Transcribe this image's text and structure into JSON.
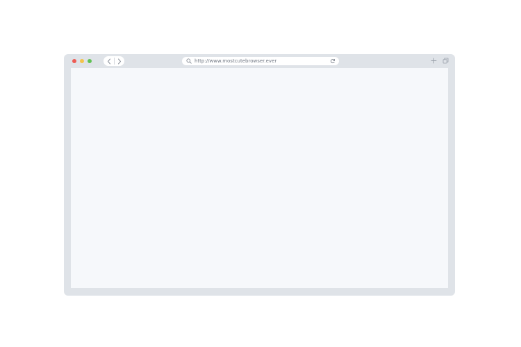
{
  "window": {
    "traffic_lights": {
      "close": "#ee5c55",
      "minimize": "#f3c44b",
      "maximize": "#5fc254"
    },
    "frame_color": "#dfe3e8",
    "content_color": "#f6f8fb"
  },
  "toolbar": {
    "back_icon": "chevron-left",
    "forward_icon": "chevron-right",
    "new_tab_icon": "plus",
    "tabs_icon": "duplicate-windows"
  },
  "address_bar": {
    "url": "http://www.mostcutebrowser.ever",
    "search_icon": "magnifier",
    "reload_icon": "reload"
  }
}
